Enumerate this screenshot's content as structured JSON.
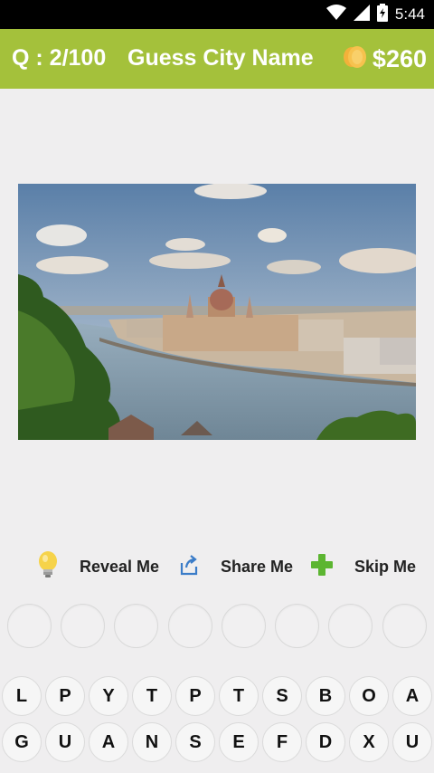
{
  "status_bar": {
    "time": "5:44",
    "icons": [
      "wifi-icon",
      "cell-signal-icon",
      "battery-icon"
    ]
  },
  "header": {
    "question": "Q : 2/100",
    "title": "Guess City Name",
    "money": "$260",
    "coin_icon": "coin-icon"
  },
  "colors": {
    "header_bg": "#a4c13b",
    "background": "#efeeef"
  },
  "actions": [
    {
      "icon": "lightbulb-icon",
      "label": "Reveal Me"
    },
    {
      "icon": "share-icon",
      "label": "Share Me"
    },
    {
      "icon": "plus-icon",
      "label": "Skip Me"
    }
  ],
  "answer_slots": 8,
  "keyboard": {
    "row1": [
      "L",
      "P",
      "Y",
      "T",
      "P",
      "T",
      "S",
      "B",
      "O",
      "A"
    ],
    "row2": [
      "G",
      "U",
      "A",
      "N",
      "S",
      "E",
      "F",
      "D",
      "X",
      "U"
    ]
  }
}
